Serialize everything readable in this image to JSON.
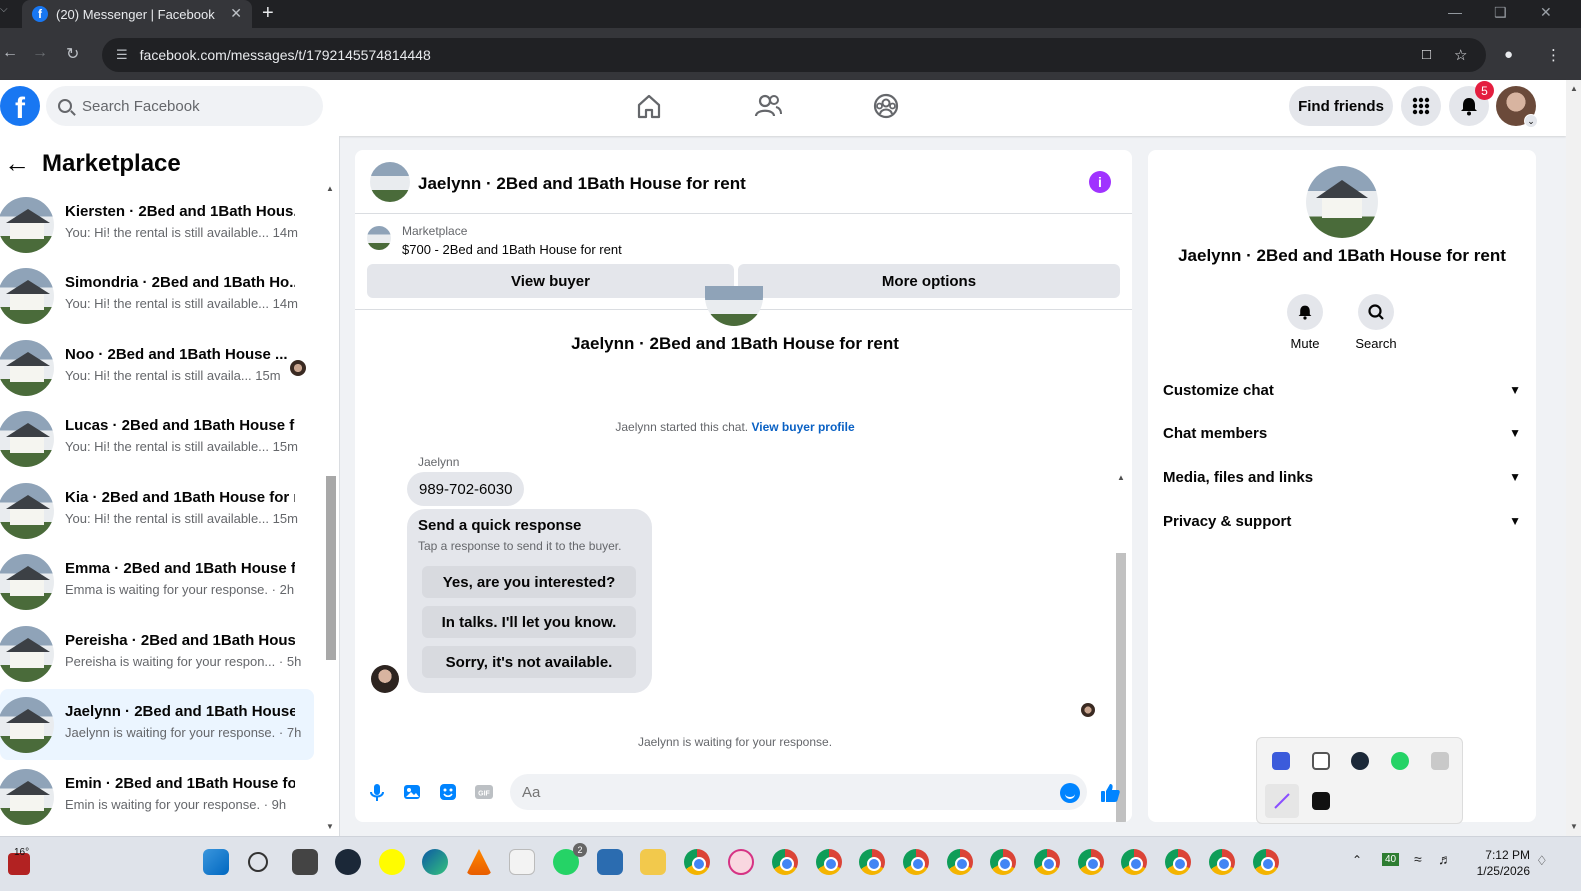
{
  "browser": {
    "tab_title": "(20) Messenger | Facebook",
    "url": "facebook.com/messages/t/1792145574814448"
  },
  "fb_header": {
    "search_placeholder": "Search Facebook",
    "find_friends": "Find friends",
    "notification_count": "5"
  },
  "left": {
    "title": "Marketplace",
    "conversations": [
      {
        "name": "Kiersten · 2Bed and 1Bath Hous...",
        "preview": "You: Hi! the rental is still available...",
        "time": "14m"
      },
      {
        "name": "Simondria · 2Bed and 1Bath Ho...",
        "preview": "You: Hi! the rental is still available...",
        "time": "14m"
      },
      {
        "name": "Noo · 2Bed and 1Bath House ...",
        "preview": "You: Hi! the rental is still availa...",
        "time": "15m"
      },
      {
        "name": "Lucas · 2Bed and 1Bath House f...",
        "preview": "You: Hi! the rental is still available...",
        "time": "15m"
      },
      {
        "name": "Kia · 2Bed and 1Bath House for r...",
        "preview": "You: Hi! the rental is still available...",
        "time": "15m"
      },
      {
        "name": "Emma · 2Bed and 1Bath House f...",
        "preview": "Emma is waiting for your response.",
        "time": "2h"
      },
      {
        "name": "Pereisha · 2Bed and 1Bath Hous...",
        "preview": "Pereisha is waiting for your respon...",
        "time": "5h"
      },
      {
        "name": "Jaelynn · 2Bed and 1Bath House...",
        "preview": "Jaelynn is waiting for your response.",
        "time": "7h"
      },
      {
        "name": "Emin · 2Bed and 1Bath House fo...",
        "preview": "Emin is waiting for your response.",
        "time": "9h"
      }
    ]
  },
  "chat": {
    "title": "Jaelynn · 2Bed and 1Bath House for rent",
    "marketplace_label": "Marketplace",
    "listing": "$700 - 2Bed and 1Bath House for rent",
    "view_buyer": "View buyer",
    "more_options": "More options",
    "started_text": "Jaelynn started this chat.",
    "view_buyer_profile": "View buyer profile",
    "sender": "Jaelynn",
    "message": "989-702-6030",
    "quick_title": "Send a quick response",
    "quick_sub": "Tap a response to send it to the buyer.",
    "quick_responses": [
      "Yes, are you interested?",
      "In talks. I'll let you know.",
      "Sorry, it's not available."
    ],
    "waiting": "Jaelynn is waiting for your response.",
    "composer_placeholder": "Aa"
  },
  "info": {
    "name": "Jaelynn · 2Bed and 1Bath House for rent",
    "mute": "Mute",
    "search": "Search",
    "sections": [
      "Customize chat",
      "Chat members",
      "Media, files and links",
      "Privacy & support"
    ]
  },
  "taskbar": {
    "temperature": "16°",
    "whatsapp_badge": "2",
    "battery": "40",
    "time": "7:12 PM",
    "date": "1/25/2026"
  },
  "colors": {
    "fb_blue": "#1877f2",
    "messenger_blue": "#0084ff",
    "info_purple": "#a033ff",
    "badge_red": "#e41e3f"
  }
}
